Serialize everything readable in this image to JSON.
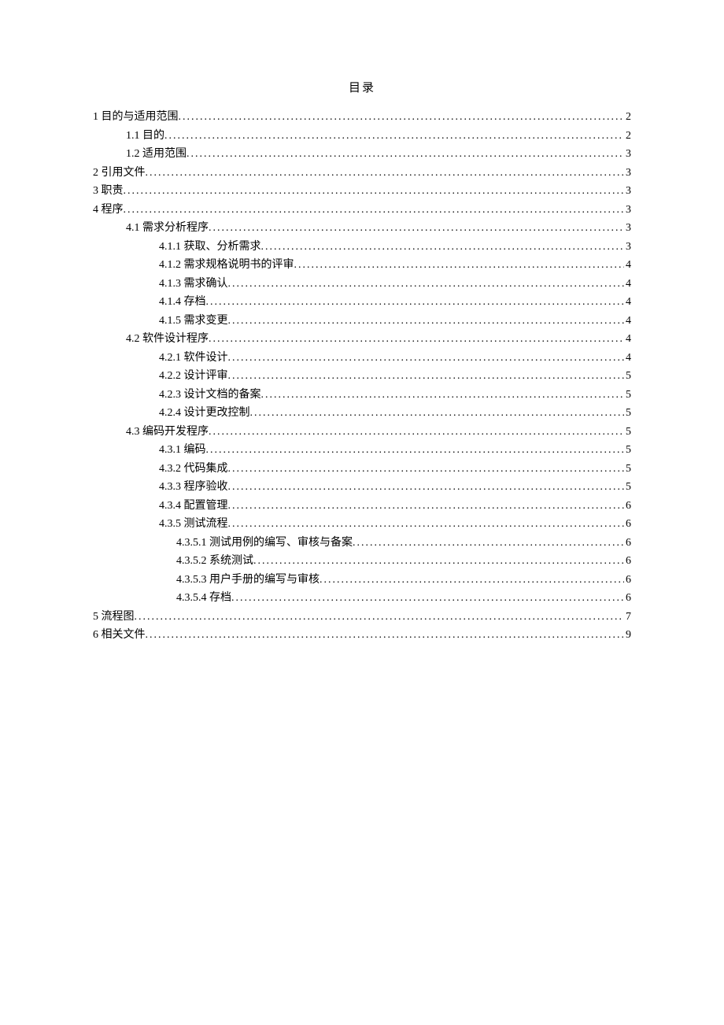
{
  "title": "目录",
  "toc": [
    {
      "label": "1 目的与适用范围",
      "page": "2",
      "indent": 0
    },
    {
      "label": "1.1  目的",
      "page": "2",
      "indent": 1
    },
    {
      "label": "1.2  适用范围",
      "page": "3",
      "indent": 1
    },
    {
      "label": "2  引用文件",
      "page": "3",
      "indent": 0
    },
    {
      "label": "3 职责",
      "page": "3",
      "indent": 0
    },
    {
      "label": "4 程序",
      "page": "3",
      "indent": 0
    },
    {
      "label": "4.1 需求分析程序",
      "page": "3",
      "indent": 1
    },
    {
      "label": "4.1.1 获取、分析需求",
      "page": "3",
      "indent": 2
    },
    {
      "label": "4.1.2 需求规格说明书的评审",
      "page": "4",
      "indent": 2
    },
    {
      "label": "4.1.3 需求确认",
      "page": "4",
      "indent": 2
    },
    {
      "label": "4.1.4 存档",
      "page": "4",
      "indent": 2
    },
    {
      "label": "4.1.5 需求变更",
      "page": "4",
      "indent": 2
    },
    {
      "label": "4.2  软件设计程序",
      "page": "4",
      "indent": 1
    },
    {
      "label": "4.2.1 软件设计",
      "page": "4",
      "indent": 2
    },
    {
      "label": "4.2.2 设计评审",
      "page": "5",
      "indent": 2
    },
    {
      "label": "4.2.3 设计文档的备案",
      "page": "5",
      "indent": 2
    },
    {
      "label": "4.2.4 设计更改控制",
      "page": "5",
      "indent": 2
    },
    {
      "label": "4.3  编码开发程序",
      "page": "5",
      "indent": 1
    },
    {
      "label": "4.3.1 编码",
      "page": "5",
      "indent": 2
    },
    {
      "label": "4.3.2 代码集成",
      "page": "5",
      "indent": 2
    },
    {
      "label": "4.3.3 程序验收",
      "page": "5",
      "indent": 2
    },
    {
      "label": "4.3.4 配置管理",
      "page": "6",
      "indent": 2
    },
    {
      "label": "4.3.5 测试流程",
      "page": "6",
      "indent": 2
    },
    {
      "label": "4.3.5.1  测试用例的编写、审核与备案",
      "page": "6",
      "indent": 3
    },
    {
      "label": "4.3.5.2  系统测试",
      "page": "6",
      "indent": 3
    },
    {
      "label": "4.3.5.3  用户手册的编写与审核",
      "page": "6",
      "indent": 3
    },
    {
      "label": "4.3.5.4 存档",
      "page": "6",
      "indent": 3
    },
    {
      "label": "5 流程图",
      "page": "7",
      "indent": 0
    },
    {
      "label": "6 相关文件",
      "page": "9",
      "indent": 0
    }
  ]
}
